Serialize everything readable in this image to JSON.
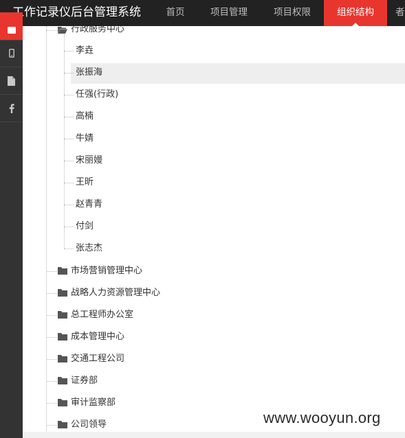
{
  "app": {
    "title": "工作记录仪后台管理系统"
  },
  "nav": {
    "items": [
      {
        "label": "首页",
        "active": false
      },
      {
        "label": "项目管理",
        "active": false
      },
      {
        "label": "项目权限",
        "active": false
      },
      {
        "label": "组织结构",
        "active": true
      },
      {
        "label": "者",
        "active": false
      }
    ]
  },
  "sidebar": {
    "items": [
      {
        "icon": "square-icon",
        "active": true
      },
      {
        "icon": "mobile-icon",
        "active": false
      },
      {
        "icon": "document-icon",
        "active": false
      },
      {
        "icon": "facebook-icon",
        "active": false
      }
    ]
  },
  "tree": {
    "expanded_folder": "行政服务中心",
    "members": [
      "李垚",
      "张振海",
      "任强(行政)",
      "高楠",
      "牛婧",
      "宋丽嫚",
      "王昕",
      "赵青青",
      "付剑",
      "张志杰"
    ],
    "selected_member": "张振海",
    "folders": [
      "市场营销管理中心",
      "战略人力资源管理中心",
      "总工程师办公室",
      "成本管理中心",
      "交通工程公司",
      "证券部",
      "审计监察部",
      "公司领导"
    ]
  },
  "watermark": "www.wooyun.org",
  "colors": {
    "accent": "#e8362f",
    "topbar": "#222222",
    "sidebar": "#333333"
  }
}
